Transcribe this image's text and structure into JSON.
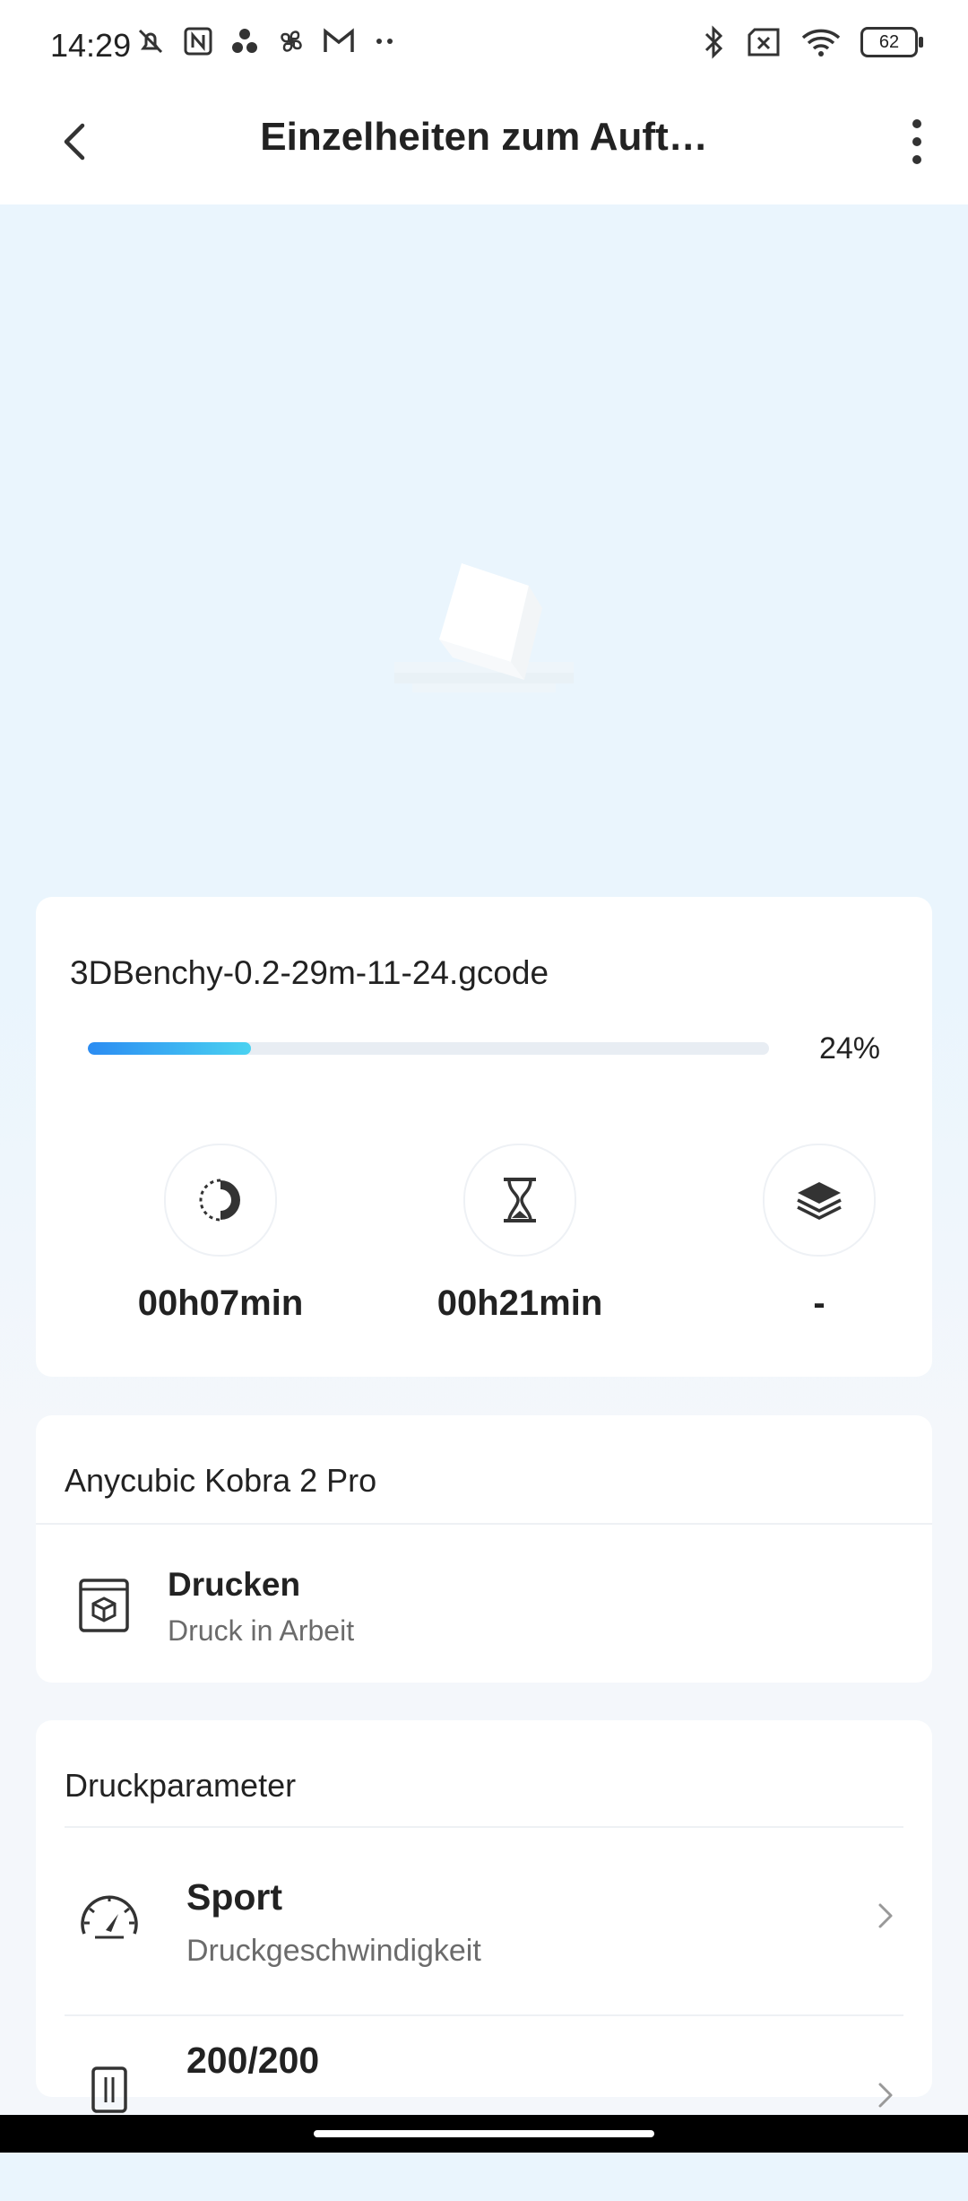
{
  "status_bar": {
    "time": "14:29",
    "battery": "62",
    "left_icons": [
      "mute-icon",
      "nfc-icon",
      "dots-app-icon",
      "fan-icon",
      "gmail-icon",
      "more-dots-icon"
    ],
    "right_icons": [
      "bluetooth-icon",
      "sim-off-icon",
      "wifi-icon",
      "battery-icon"
    ]
  },
  "app_bar": {
    "title": "Einzelheiten zum Auft…"
  },
  "job": {
    "filename": "3DBenchy-0.2-29m-11-24.gcode",
    "progress_percent": 24,
    "progress_label": "24%",
    "stats": [
      {
        "icon": "elapsed-time-icon",
        "value": "00h07min"
      },
      {
        "icon": "hourglass-icon",
        "value": "00h21min"
      },
      {
        "icon": "layers-icon",
        "value": "-"
      }
    ]
  },
  "printer": {
    "name": "Anycubic Kobra 2 Pro",
    "status_title": "Drucken",
    "status_sub": "Druck in Arbeit"
  },
  "params": {
    "title": "Druckparameter",
    "rows": [
      {
        "icon": "speedometer-icon",
        "title": "Sport",
        "sub": "Druckgeschwindigkeit"
      },
      {
        "icon": "thermometer-icon",
        "title": "200/200",
        "sub": ""
      }
    ]
  },
  "colors": {
    "accent_start": "#2b8cf2",
    "accent_end": "#4ad2f1",
    "preview_bg": "#eaf5fd"
  }
}
